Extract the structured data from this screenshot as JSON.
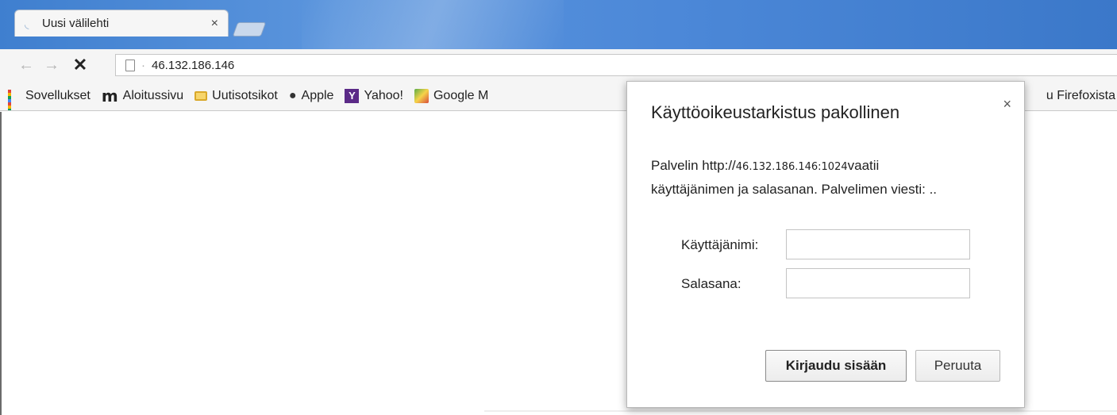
{
  "tab": {
    "title": "Uusi välilehti",
    "close": "×"
  },
  "toolbar": {
    "back": "←",
    "forward": "→",
    "stop": "✕",
    "address": "46.132.186.146"
  },
  "bookmarks": {
    "items": [
      {
        "label": "Sovellukset",
        "icon": "apps-icon"
      },
      {
        "label": "Aloitussivu",
        "icon": "m-logo-icon"
      },
      {
        "label": "Uutisotsikot",
        "icon": "folder-icon"
      },
      {
        "label": "Apple",
        "icon": "apple-icon"
      },
      {
        "label": "Yahoo!",
        "icon": "yahoo-icon"
      },
      {
        "label": "Google M",
        "icon": "google-maps-icon"
      }
    ],
    "overflow_label": "u Firefoxista"
  },
  "dialog": {
    "title": "Käyttöoikeustarkistus pakollinen",
    "close": "×",
    "message_prefix": "Palvelin http://",
    "message_host": "46.132.186.146:1024",
    "message_suffix": "vaatii",
    "message_line2": "käyttäjänimen ja salasanan. Palvelimen viesti: ..",
    "username_label": "Käyttäjänimi:",
    "username_value": "",
    "password_label": "Salasana:",
    "password_value": "",
    "login_button": "Kirjaudu sisään",
    "cancel_button": "Peruuta"
  },
  "colors": {
    "tabstrip": "#4c88d8",
    "toolbar": "#f5f5f5",
    "apps_grid": [
      "#e0443a",
      "#f4b400",
      "#0f9d58",
      "#4285f4"
    ],
    "yahoo": "#5b2a87",
    "folder": "#f7d56b"
  }
}
